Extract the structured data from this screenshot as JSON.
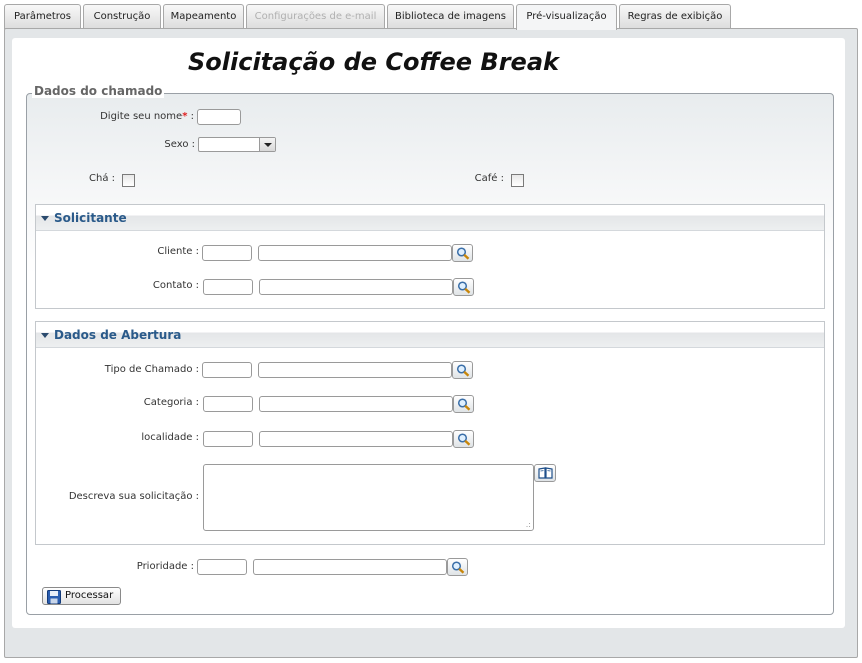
{
  "tabs": [
    {
      "label": "Parâmetros"
    },
    {
      "label": "Construção"
    },
    {
      "label": "Mapeamento"
    },
    {
      "label": "Configurações de e-mail"
    },
    {
      "label": "Biblioteca de imagens"
    },
    {
      "label": "Pré-visualização"
    },
    {
      "label": "Regras de exibição"
    }
  ],
  "active_tab": "Pré-visualização",
  "disabled_tab": "Configurações de e-mail",
  "form": {
    "title": "Solicitação de Coffee Break",
    "fieldset_legend": "Dados do chamado",
    "nome_label": "Digite seu nome",
    "required_mark": "*",
    "label_suffix": ":",
    "sexo_label": "Sexo :",
    "cha_label": "Chá :",
    "cafe_label": "Café :",
    "cha_checked": false,
    "cafe_checked": false,
    "solicitante": {
      "title": "Solicitante",
      "cliente_label": "Cliente :",
      "contato_label": "Contato :"
    },
    "abertura": {
      "title": "Dados de Abertura",
      "tipo_label": "Tipo de Chamado :",
      "categoria_label": "Categoria :",
      "localidade_label": "localidade :",
      "descreva_label": "Descreva sua solicitação :"
    },
    "prioridade_label": "Prioridade :",
    "processar_label": "Processar"
  },
  "icons": {
    "lookup": "magnifier-icon",
    "book": "book-icon",
    "save": "floppy-disk-icon"
  }
}
